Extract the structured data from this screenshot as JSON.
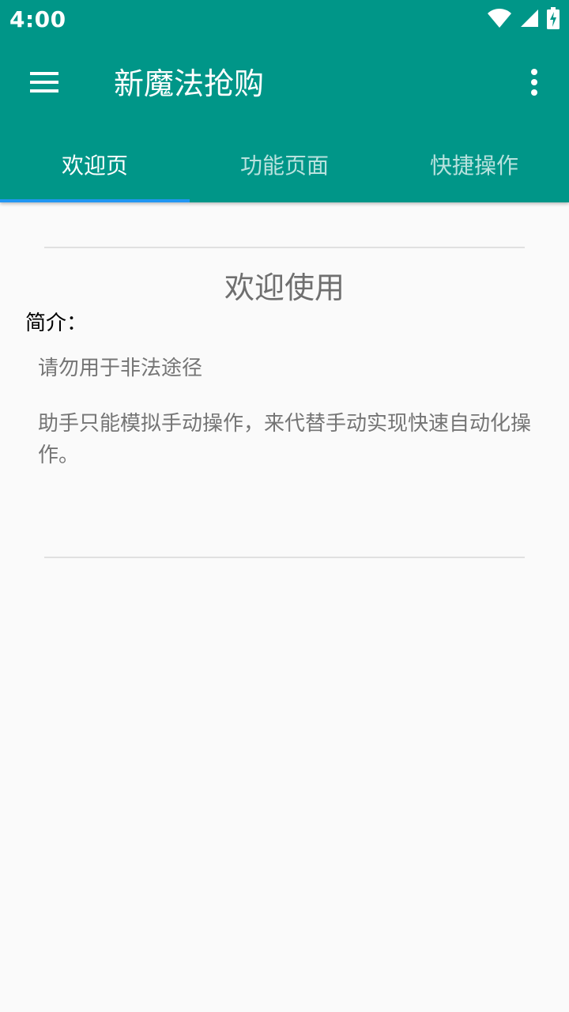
{
  "status_bar": {
    "time": "4:00",
    "icons": [
      "wifi-icon",
      "cell-signal-icon",
      "battery-charging-icon"
    ]
  },
  "toolbar": {
    "title": "新魔法抢购",
    "menu_icon": "hamburger-menu-icon",
    "overflow_icon": "more-vertical-icon"
  },
  "tabs": [
    {
      "label": "欢迎页",
      "active": true
    },
    {
      "label": "功能页面",
      "active": false
    },
    {
      "label": "快捷操作",
      "active": false
    }
  ],
  "content": {
    "title": "欢迎使用",
    "intro_label": "简介：",
    "paragraphs": [
      "请勿用于非法途径",
      "助手只能模拟手动操作，来代替手动实现快速自动化操作。"
    ]
  },
  "colors": {
    "primary": "#009688",
    "tab_indicator": "#2196f3",
    "background": "#fafafa"
  }
}
